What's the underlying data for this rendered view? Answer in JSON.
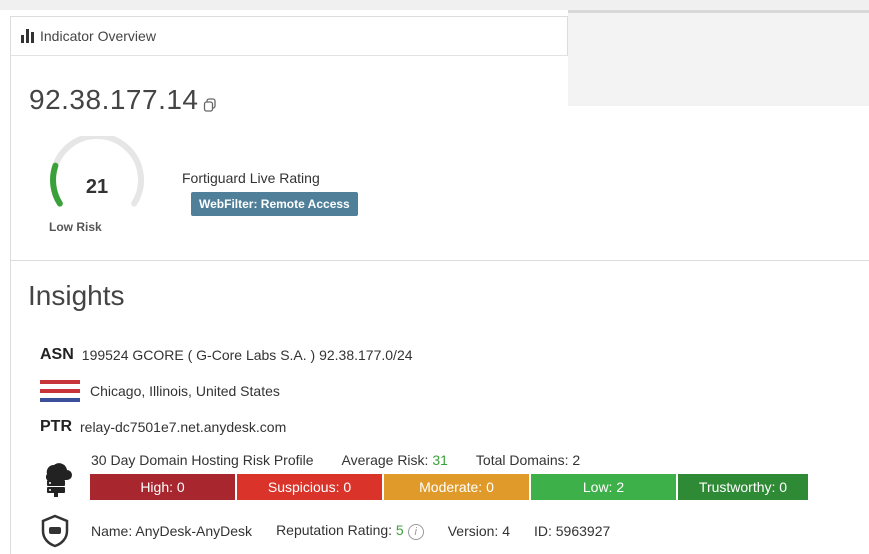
{
  "header": {
    "title": "Indicator Overview",
    "icon": "bar-chart-icon"
  },
  "indicator": {
    "ip": "92.38.177.14",
    "copy_icon": "copy-icon"
  },
  "gauge": {
    "score": "21",
    "label": "Low Risk",
    "level": 0.21,
    "color": "#3aa13a",
    "track_color": "#e6e6e6"
  },
  "rating": {
    "title": "Fortiguard Live Rating",
    "badge": "WebFilter: Remote Access",
    "badge_color": "#4f7f99"
  },
  "insights": {
    "title": "Insights",
    "asn": {
      "tag": "ASN",
      "text": "199524 GCORE ( G-Core Labs S.A. ) 92.38.177.0/24"
    },
    "location": {
      "flag_icon": "us-flag-icon",
      "text": "Chicago, Illinois, United States"
    },
    "ptr": {
      "tag": "PTR",
      "text": "relay-dc7501e7.net.anydesk.com"
    },
    "hosting": {
      "title": "30 Day Domain Hosting Risk Profile",
      "avg_label": "Average Risk:",
      "avg_value": "31",
      "total_label": "Total Domains: 2",
      "segments": [
        {
          "label": "High: 0",
          "color": "#a8262e"
        },
        {
          "label": "Suspicious: 0",
          "color": "#d9332a"
        },
        {
          "label": "Moderate: 0",
          "color": "#e09a2a"
        },
        {
          "label": "Low: 2",
          "color": "#3db04a"
        },
        {
          "label": "Trustworthy: 0",
          "color": "#2f8a36"
        }
      ]
    },
    "app": {
      "name": "Name: AnyDesk-AnyDesk",
      "rep_label": "Reputation Rating:",
      "rep_value": "5",
      "version": "Version: 4",
      "id": "ID: 5963927"
    }
  }
}
